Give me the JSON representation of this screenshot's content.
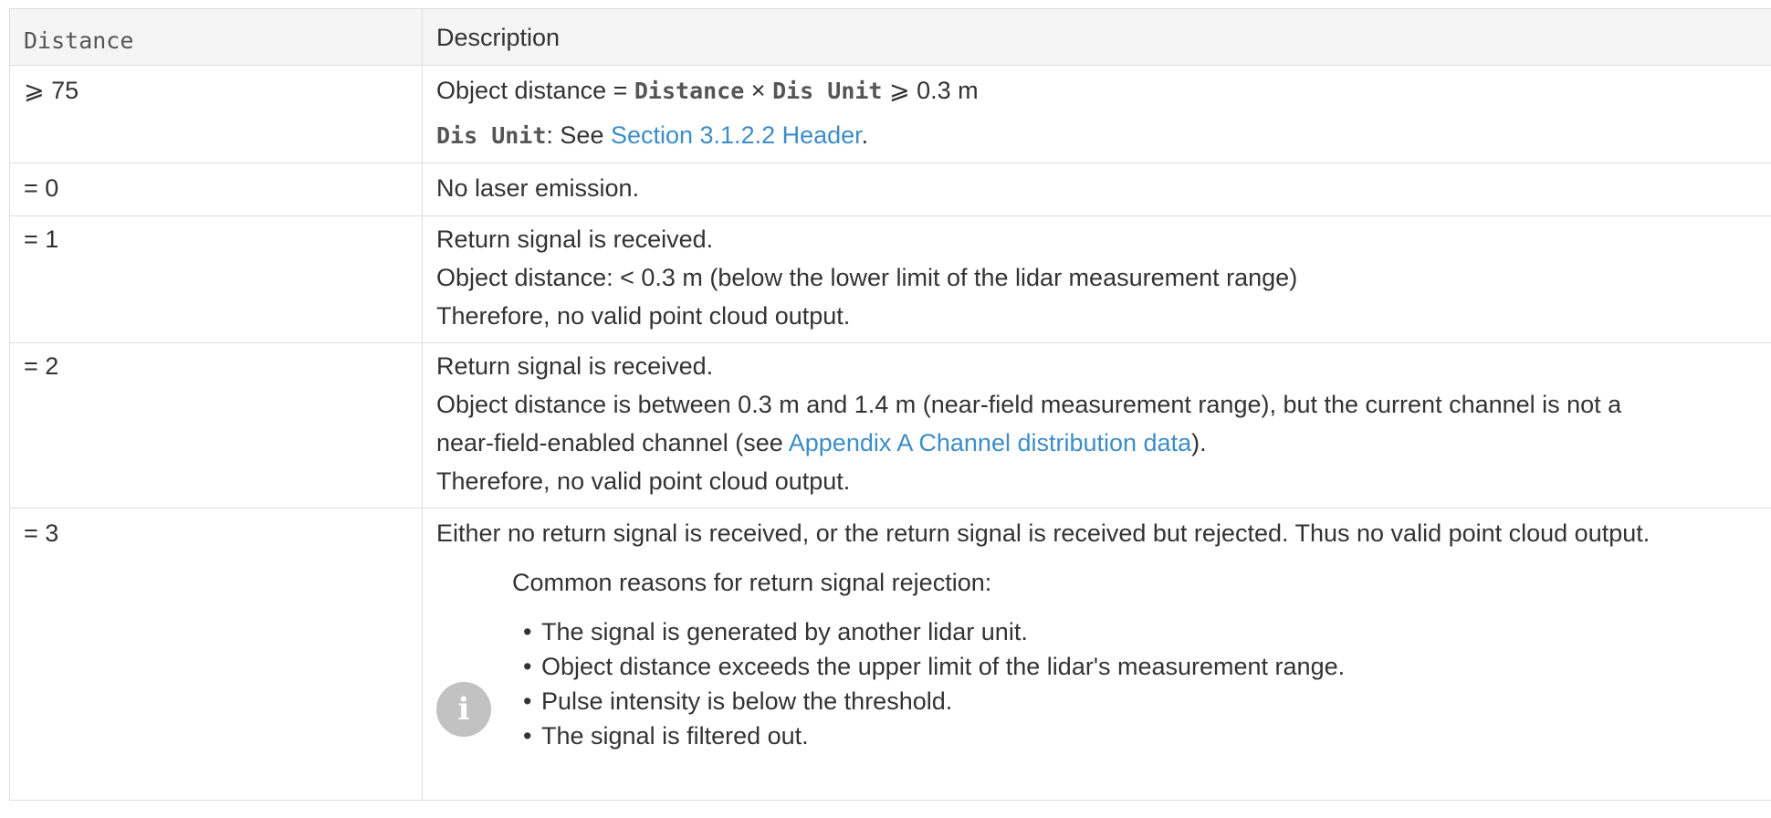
{
  "table": {
    "headers": {
      "distance": "Distance",
      "description": "Description"
    },
    "rows": [
      {
        "distance": "⩾ 75",
        "desc": {
          "prefix": "Object distance = ",
          "code1": "Distance",
          "times": " × ",
          "code2": "Dis Unit",
          "suffix": " ⩾ 0.3 m",
          "unit_code": "Dis Unit",
          "see_text": ": See ",
          "link": "Section 3.1.2.2 Header",
          "end": "."
        }
      },
      {
        "distance": "= 0",
        "desc": {
          "line1": "No laser emission."
        }
      },
      {
        "distance": "= 1",
        "desc": {
          "line1": "Return signal is received.",
          "line2": "Object distance: < 0.3 m (below the lower limit of the lidar measurement range)",
          "line3": "Therefore, no valid point cloud output."
        }
      },
      {
        "distance": "= 2",
        "desc": {
          "line1": "Return signal is received.",
          "line2": "Object distance is between 0.3 m and 1.4 m (near-field measurement range), but the current channel is not a",
          "line3_prefix": "near-field-enabled channel (see ",
          "line3_link": "Appendix A Channel distribution data",
          "line3_suffix": ").",
          "line4": "Therefore, no valid point cloud output."
        }
      },
      {
        "distance": "= 3",
        "desc": {
          "line1": "Either no return signal is received, or the return signal is received but rejected. Thus no valid point cloud output.",
          "note_icon": "info-icon",
          "note_title": "Common reasons for return signal rejection:",
          "bullet": "•",
          "reasons": [
            "The signal is generated by another lidar unit.",
            "Object distance exceeds the upper limit of the lidar's measurement range.",
            "Pulse intensity is below the threshold.",
            "The signal is filtered out."
          ]
        }
      }
    ]
  },
  "colors": {
    "link": "#3c8dc8",
    "border": "#dddddd",
    "header_bg": "#f5f5f5",
    "icon_bg": "#c2c2c2",
    "text": "#333333"
  }
}
